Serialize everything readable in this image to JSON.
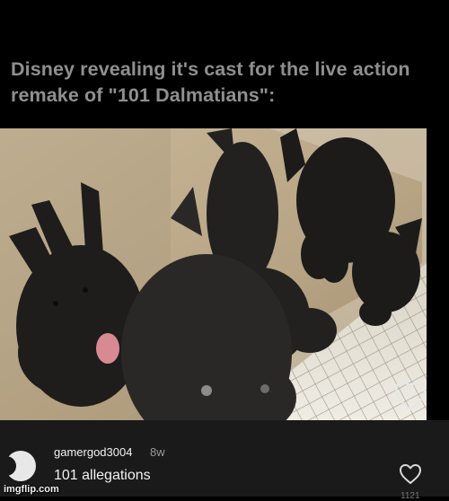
{
  "post": {
    "caption": "Disney revealing it's cast for the live action remake of \"101 Dalmatians\":"
  },
  "comment": {
    "username": "gamergod3004",
    "timestamp": "8w",
    "text": "101 allegations",
    "like_count": "1121"
  },
  "watermark": {
    "text": "imgflip.com"
  },
  "icons": {
    "photo_like": "heart-outline-icon",
    "comment_like": "heart-outline-icon"
  },
  "colors": {
    "background": "#000000",
    "caption_text": "#8f8f8f",
    "comment_panel": "#1a1a1a",
    "primary_text": "#f2f2f2",
    "secondary_text": "#9a9a9a"
  }
}
